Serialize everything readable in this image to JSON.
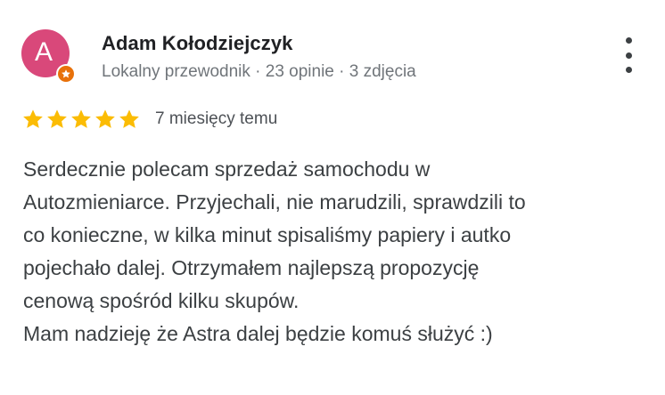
{
  "review": {
    "author": {
      "avatar_letter": "A",
      "avatar_color": "#d9487a",
      "badge_icon": "local-guide-star-icon",
      "badge_color": "#e8710a",
      "name": "Adam Kołodziejczyk",
      "meta": "Lokalny przewodnik · 23 opinie · 3 zdjęcia"
    },
    "menu_icon": "more-vert-icon",
    "rating": 5,
    "star_color": "#fbbc04",
    "date": "7 miesięcy temu",
    "text_lines": [
      "Serdecznie polecam sprzedaż samochodu w",
      "Autozmieniarce. Przyjechali, nie marudzili, sprawdzili to",
      "co konieczne, w kilka minut spisaliśmy papiery i autko",
      "pojechało dalej. Otrzymałem najlepszą propozycję",
      "cenową spośród kilku skupów.",
      "Mam nadzieję że Astra dalej będzie komuś służyć :)"
    ]
  }
}
